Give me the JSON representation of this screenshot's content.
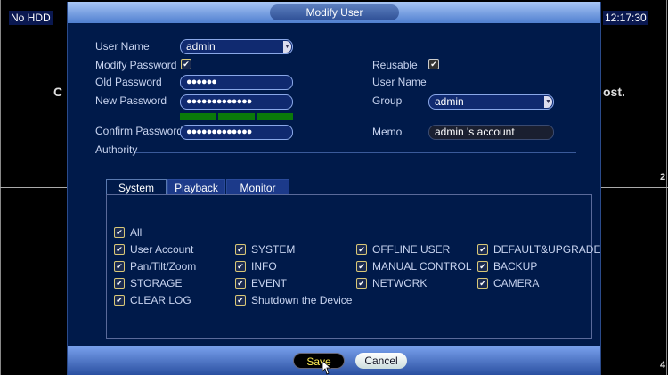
{
  "background": {
    "hdd_status": "No HDD",
    "clock": "12:17:30",
    "left_fragment": "C",
    "right_fragment": "ost.",
    "channel_2": "2",
    "channel_4": "4"
  },
  "dialog": {
    "title": "Modify User",
    "user_name_label": "User Name",
    "user_name_value": "admin",
    "modify_password_label": "Modify Password",
    "modify_password_checked": true,
    "old_password_label": "Old Password",
    "old_password_value": "●●●●●●",
    "new_password_label": "New Password",
    "new_password_value": "●●●●●●●●●●●●●",
    "password_strength": "3/3",
    "confirm_password_label": "Confirm Password",
    "confirm_password_value": "●●●●●●●●●●●●●",
    "reusable_label": "Reusable",
    "reusable_checked": true,
    "user_name_right_label": "User Name",
    "group_label": "Group",
    "group_value": "admin",
    "memo_label": "Memo",
    "memo_value": "admin 's account",
    "authority_label": "Authority",
    "tabs": [
      {
        "label": "System",
        "active": true
      },
      {
        "label": "Playback",
        "active": false
      },
      {
        "label": "Monitor",
        "active": false
      }
    ],
    "permissions": {
      "all": "All",
      "col1": [
        "User Account",
        "Pan/Tilt/Zoom",
        "STORAGE",
        "CLEAR LOG"
      ],
      "col2": [
        "SYSTEM",
        "INFO",
        "EVENT",
        "Shutdown the Device"
      ],
      "col3": [
        "OFFLINE USER",
        "MANUAL CONTROL",
        "NETWORK"
      ],
      "col4": [
        "DEFAULT&UPGRADE",
        "BACKUP",
        "CAMERA"
      ]
    },
    "save_label": "Save",
    "cancel_label": "Cancel",
    "colors": {
      "dialog_bg": "#001a4a",
      "strength": "#0a7a0a",
      "save_text": "#ffee55"
    }
  }
}
